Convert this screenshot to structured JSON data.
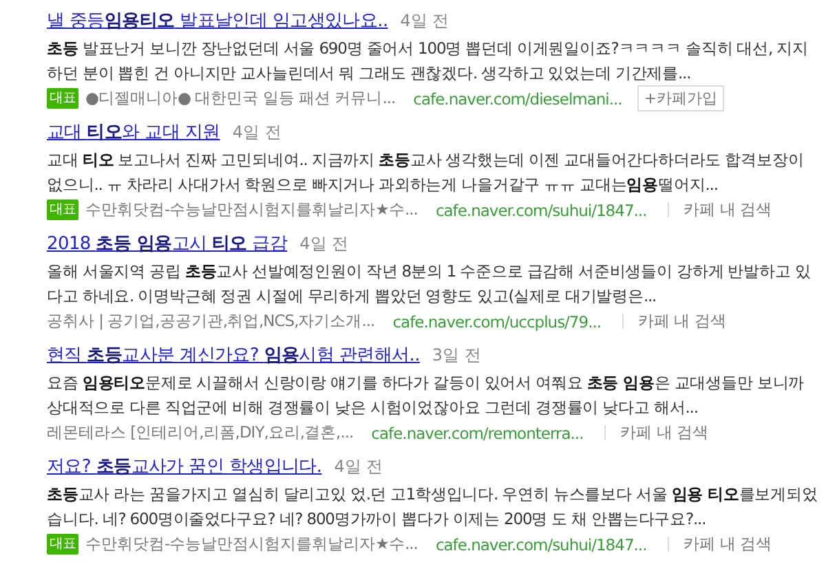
{
  "results": [
    {
      "title": "낼 중등**임용티오** 발표날인데 임고생있나요..",
      "age": "4일 전",
      "snippet": "**초등** 발표난거 보니깐 장난없던데 서울 690명 줄어서 100명 뽑던데 이게뭔일이죠?ㅋㅋㅋㅋ 솔직히 대선, 지지하던 분이 뽑힌 건 아니지만 교사늘린데서 뭐 그래도 괜찮겠다. 생각하고 있었는데 기간제를...",
      "badge": "대표",
      "cafe": "●디젤매니아● 대한민국 일등 패션 커뮤니...",
      "url": "cafe.naver.com/dieselmani...",
      "action": {
        "kind": "join",
        "label": "+카페가입"
      }
    },
    {
      "title": "교대 **티오**와 교대 지원",
      "age": "4일 전",
      "snippet": "교대 **티오** 보고나서 진짜 고민되네여.. 지금까지 **초등**교사 생각했는데 이젠 교대들어간다하더라도 합격보장이 없으니.. ㅠ 차라리 사대가서 학원으로 빠지거나 과외하는게 나을거같구 ㅠㅠ 교대는**임용**떨어지...",
      "badge": "대표",
      "cafe": "수만휘닷컴-수능날만점시험지를휘날리자★수...",
      "url": "cafe.naver.com/suhui/1847...",
      "action": {
        "kind": "search",
        "label": "카페 내 검색"
      }
    },
    {
      "title": "2018 **초등 임용**고시 **티오** 급감",
      "age": "4일 전",
      "snippet": "올해 서울지역 공립 **초등**교사 선발예정인원이 작년 8분의 1 수준으로 급감해 서준비생들이 강하게 반발하고 있다고 하네요. 이명박근혜 정권 시절에 무리하게 뽑았던 영향도 있고(실제로 대기발령은...",
      "cafe": "공취사 | 공기업,공공기관,취업,NCS,자기소개...",
      "url": "cafe.naver.com/uccplus/79...",
      "action": {
        "kind": "search",
        "label": "카페 내 검색"
      }
    },
    {
      "title": "현직 **초등**교사분 계신가요? **임용**시험 관련해서..",
      "age": "3일 전",
      "snippet": "요즘 **임용티오**문제로 시끌해서 신랑이랑 얘기를 하다가 갈등이 있어서 여쭤요 **초등 임용**은 교대생들만 보니까 상대적으로 다른 직업군에 비해 경쟁률이 낮은 시험이었잖아요 그런데 경쟁률이 낮다고 해서...",
      "cafe": "레몬테라스 [인테리어,리폼,DIY,요리,결혼,...",
      "url": "cafe.naver.com/remonterra...",
      "action": {
        "kind": "search",
        "label": "카페 내 검색"
      }
    },
    {
      "title": "저요? **초등**교사가 꿈인 학생입니다.",
      "age": "4일 전",
      "snippet": "**초등**교사 라는 꿈을가지고 열심히 달리고있 었.던 고1학생입니다. 우연히 뉴스를보다 서울 **임용 티오**를보게되었습니다. 네? 600명이줄었다구요? 네? 800명가까이 뽑다가 이제는 200명 도 채 안뽑는다구요?...",
      "badge": "대표",
      "cafe": "수만휘닷컴-수능날만점시험지를휘날리자★수...",
      "url": "cafe.naver.com/suhui/1847...",
      "action": {
        "kind": "search",
        "label": "카페 내 검색"
      }
    }
  ]
}
